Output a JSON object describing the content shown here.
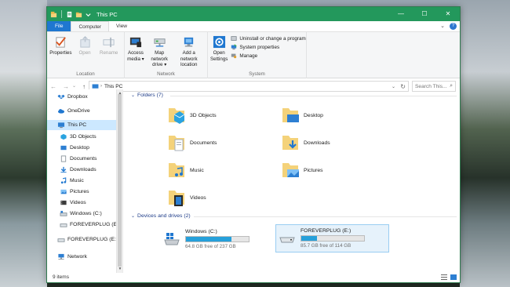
{
  "window": {
    "title": "This PC",
    "minimize": "—",
    "maximize": "☐",
    "close": "✕"
  },
  "ribbon_tabs": [
    {
      "label": "File"
    },
    {
      "label": "Computer"
    },
    {
      "label": "View"
    }
  ],
  "ribbon": {
    "location": {
      "group_label": "Location",
      "properties": "Properties",
      "open": "Open",
      "rename": "Rename"
    },
    "network": {
      "group_label": "Network",
      "access_media_1": "Access",
      "access_media_2": "media ▾",
      "map_drive_1": "Map network",
      "map_drive_2": "drive ▾",
      "add_location_1": "Add a network",
      "add_location_2": "location"
    },
    "system": {
      "group_label": "System",
      "open_settings_1": "Open",
      "open_settings_2": "Settings",
      "uninstall": "Uninstall or change a program",
      "system_properties": "System properties",
      "manage": "Manage"
    }
  },
  "address": {
    "path": "This PC",
    "search_placeholder": "Search This..."
  },
  "nav_pane": {
    "items": [
      {
        "label": "Dropbox"
      },
      {
        "label": "OneDrive"
      },
      {
        "label": "This PC"
      },
      {
        "label": "3D Objects"
      },
      {
        "label": "Desktop"
      },
      {
        "label": "Documents"
      },
      {
        "label": "Downloads"
      },
      {
        "label": "Music"
      },
      {
        "label": "Pictures"
      },
      {
        "label": "Videos"
      },
      {
        "label": "Windows (C:)"
      },
      {
        "label": "FOREVERPLUG (E:)"
      },
      {
        "label": "FOREVERPLUG (E:)"
      },
      {
        "label": "Network"
      }
    ]
  },
  "content": {
    "folders_header": "Folders (7)",
    "folders": [
      {
        "label": "3D Objects"
      },
      {
        "label": "Desktop"
      },
      {
        "label": "Documents"
      },
      {
        "label": "Downloads"
      },
      {
        "label": "Music"
      },
      {
        "label": "Pictures"
      },
      {
        "label": "Videos"
      }
    ],
    "drives_header": "Devices and drives (2)",
    "drives": [
      {
        "label": "Windows (C:)",
        "free": "64.8 GB free of 237 GB",
        "used_fraction": 0.727
      },
      {
        "label": "FOREVERPLUG (E:)",
        "free": "85.7 GB free of 114 GB",
        "used_fraction": 0.248
      }
    ]
  },
  "status": {
    "items": "9 items"
  },
  "colors": {
    "titlebar": "#23985c",
    "file_tab": "#1f77d0",
    "drive_fill": "#26a0da",
    "section_header": "#1e3c88"
  }
}
